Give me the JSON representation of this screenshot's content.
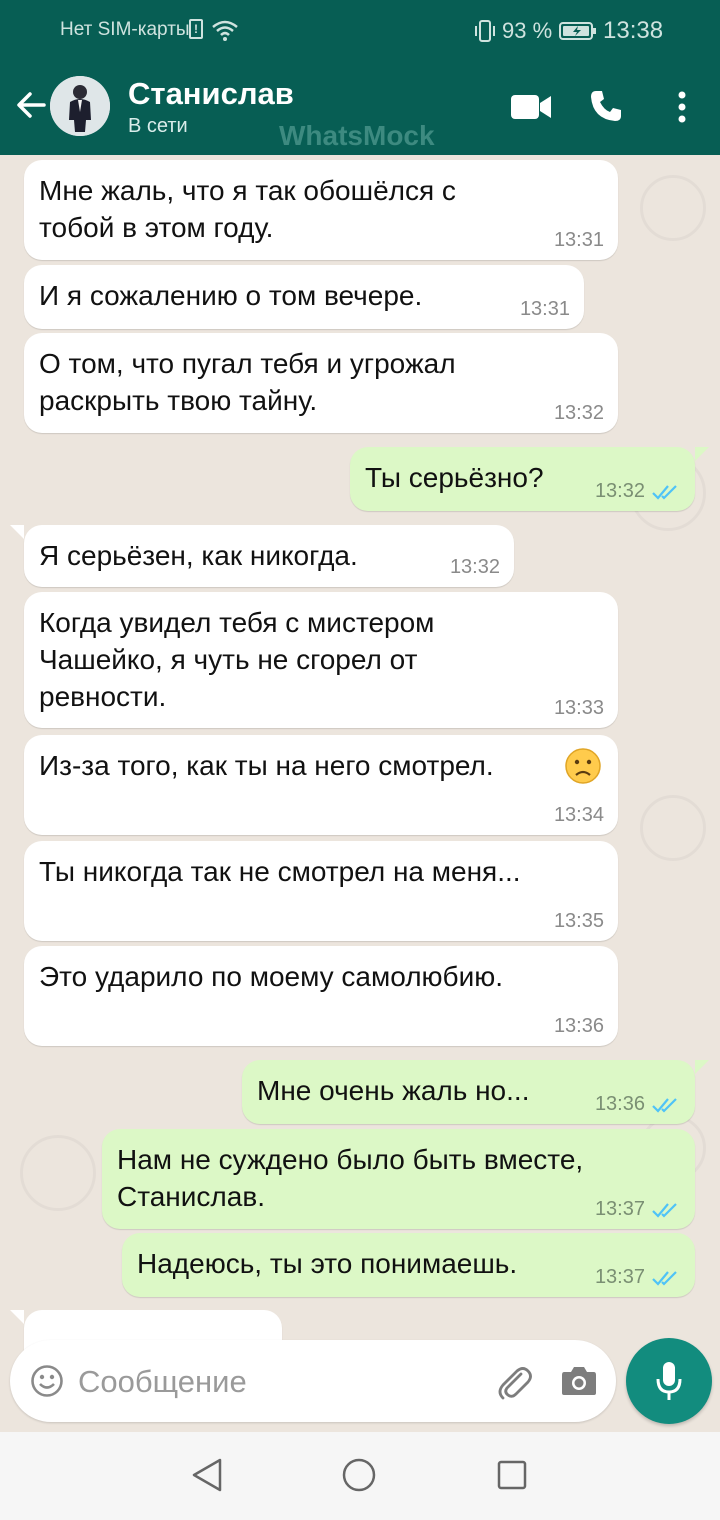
{
  "status_bar": {
    "carrier": "Нет SIM-карты",
    "battery": "93 %",
    "time": "13:38",
    "sim_glyph": "!"
  },
  "header": {
    "contact_name": "Станислав",
    "contact_status": "В сети",
    "watermark": "WhatsMock",
    "icons": [
      "back-arrow-icon",
      "avatar",
      "video-call-icon",
      "phone-icon",
      "more-vert-icon"
    ]
  },
  "messages": [
    {
      "dir": "in",
      "text": " Мне жаль, что я так обошёлся с\nтобой в этом году.",
      "time": "13:31"
    },
    {
      "dir": "in",
      "text": "И я сожалению о том вечере.",
      "time": "13:31"
    },
    {
      "dir": "in",
      "text": "О том, что пугал тебя и угрожал\nраскрыть твою тайну.",
      "time": "13:32"
    },
    {
      "dir": "out",
      "text": "Ты серьёзно?",
      "time": "13:32"
    },
    {
      "dir": "in",
      "text": "Я серьёзен, как никогда.",
      "time": "13:32"
    },
    {
      "dir": "in",
      "text": "Когда увидел тебя с мистером\nЧашейко, я чуть не сгорел от\nревности.",
      "time": "13:33"
    },
    {
      "dir": "in",
      "text": "Из-за того, как ты на него смотрел.",
      "time": "13:34"
    },
    {
      "dir": "in",
      "text": "Ты никогда так не смотрел на меня...",
      "time": "13:35"
    },
    {
      "dir": "in",
      "text": "Это ударило по моему самолюбию.",
      "time": "13:36"
    },
    {
      "dir": "out",
      "text": "Мне очень жаль но...",
      "time": "13:36"
    },
    {
      "dir": "out",
      "text": "Нам не суждено было быть вместе,\nСтанислав.",
      "time": "13:37"
    },
    {
      "dir": "out",
      "text": "Надеюсь, ты это понимаешь.",
      "time": "13:37"
    }
  ],
  "composer": {
    "placeholder": "Сообщение",
    "icons": [
      "emoji-icon",
      "attach-clip-icon",
      "camera-icon",
      "mic-icon"
    ]
  },
  "colors": {
    "header": "#075e54",
    "chat_bg": "#ece5dd",
    "bubble_in": "#ffffff",
    "bubble_out": "#dcf8c6",
    "read_ticks": "#4fc3f7",
    "fab": "#128c7e"
  }
}
